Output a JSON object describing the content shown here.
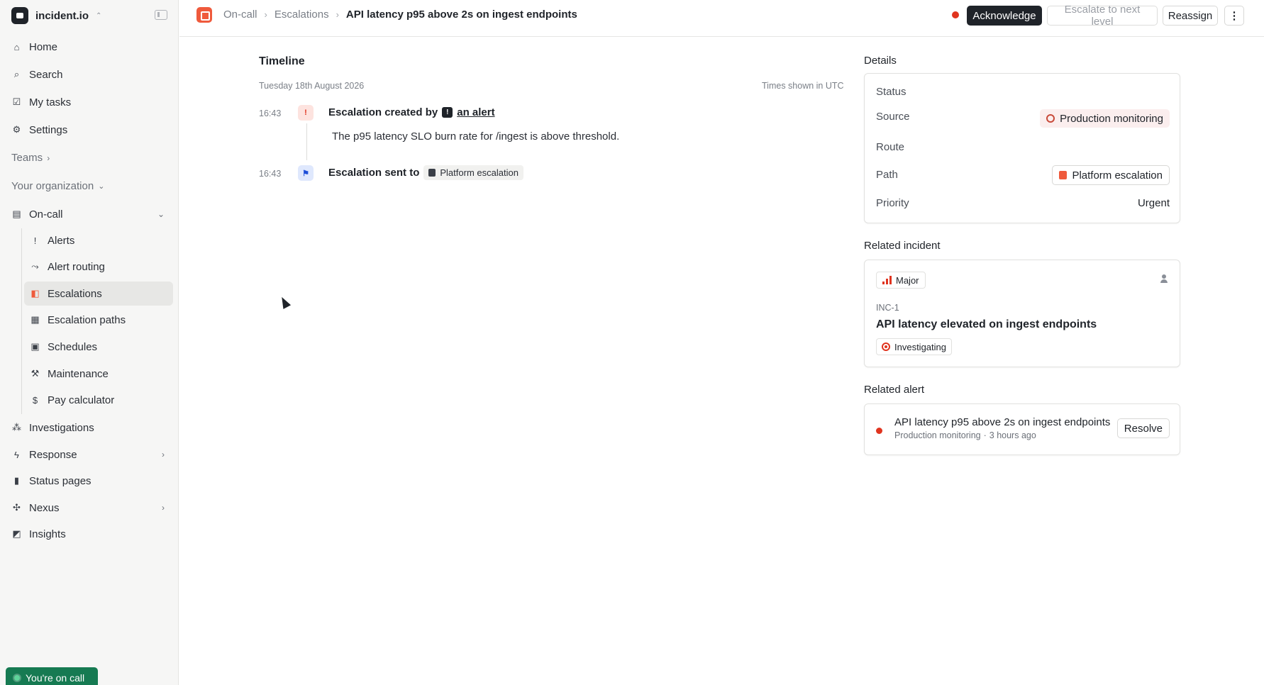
{
  "sidebar": {
    "org_name": "incident.io",
    "nav_top": [
      {
        "label": "Home",
        "icon": "home-icon"
      },
      {
        "label": "Search",
        "icon": "search-icon"
      },
      {
        "label": "My tasks",
        "icon": "tasks-icon"
      },
      {
        "label": "Settings",
        "icon": "gear-icon"
      }
    ],
    "teams_label": "Teams",
    "org_section_label": "Your organization",
    "oncall_label": "On-call",
    "oncall_items": [
      {
        "label": "Alerts",
        "icon": "alert-icon"
      },
      {
        "label": "Alert routing",
        "icon": "routing-icon"
      },
      {
        "label": "Escalations",
        "icon": "escalation-icon",
        "active": true
      },
      {
        "label": "Escalation paths",
        "icon": "path-icon"
      },
      {
        "label": "Schedules",
        "icon": "calendar-icon"
      },
      {
        "label": "Maintenance",
        "icon": "hammer-icon"
      },
      {
        "label": "Pay calculator",
        "icon": "dollar-icon"
      }
    ],
    "nav_bottom": [
      {
        "label": "Investigations",
        "icon": "investigations-icon"
      },
      {
        "label": "Response",
        "icon": "bolt-icon"
      },
      {
        "label": "Status pages",
        "icon": "status-pages-icon"
      },
      {
        "label": "Nexus",
        "icon": "nexus-icon"
      },
      {
        "label": "Insights",
        "icon": "insights-icon"
      }
    ],
    "oncall_status": "You're on call"
  },
  "header": {
    "breadcrumbs": [
      "On-call",
      "Escalations"
    ],
    "current": "API latency p95 above 2s on ingest endpoints",
    "acknowledge_label": "Acknowledge",
    "escalate_label": "Escalate to next level",
    "reassign_label": "Reassign",
    "more_label": "⋮",
    "status_color": "#e0341f"
  },
  "timeline": {
    "title": "Timeline",
    "date": "Tuesday 18th August 2026",
    "timezone_note": "Times shown in UTC",
    "events": [
      {
        "time": "16:43",
        "text": "Escalation created by",
        "link": "an alert",
        "description": "The p95 latency SLO burn rate for /ingest is above threshold."
      },
      {
        "time": "16:43",
        "text": "Escalation sent to",
        "tag": "Platform escalation"
      }
    ]
  },
  "details": {
    "label": "Details",
    "status_key": "Status",
    "source_key": "Source",
    "source_value": "Production monitoring",
    "route_key": "Route",
    "path_key": "Path",
    "path_value": "Platform escalation",
    "priority_key": "Priority",
    "priority_value": "Urgent"
  },
  "related_incident": {
    "label": "Related incident",
    "severity": "Major",
    "ref": "INC-1",
    "title": "API latency elevated on ingest endpoints",
    "status": "Investigating"
  },
  "related_alert": {
    "label": "Related alert",
    "title": "API latency p95 above 2s on ingest endpoints",
    "source": "Production monitoring",
    "separator": "·",
    "age": "3 hours ago",
    "resolve_label": "Resolve"
  }
}
